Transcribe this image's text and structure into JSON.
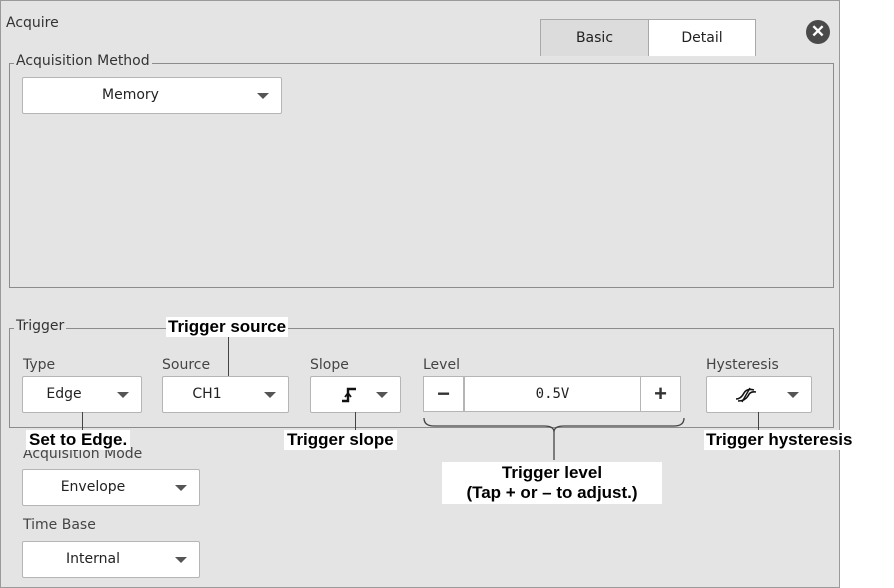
{
  "window": {
    "title": "Acquire",
    "close_icon": "close-icon"
  },
  "tabs": [
    {
      "label": "Basic"
    },
    {
      "label": "Detail"
    }
  ],
  "acquisition_method": {
    "group_label": "Acquisition Method",
    "value": "Memory"
  },
  "trigger": {
    "group_label": "Trigger",
    "type": {
      "label": "Type",
      "value": "Edge"
    },
    "source": {
      "label": "Source",
      "value": "CH1"
    },
    "slope": {
      "label": "Slope",
      "icon": "rising-edge-icon"
    },
    "level": {
      "label": "Level",
      "value": "0.5V",
      "minus": "−",
      "plus": "+"
    },
    "hysteresis": {
      "label": "Hysteresis",
      "icon": "hysteresis-icon"
    }
  },
  "acquisition_mode": {
    "label": "Acquisition Mode",
    "value": "Envelope"
  },
  "time_base": {
    "label": "Time Base",
    "value": "Internal"
  },
  "callouts": {
    "trigger_source": "Trigger source",
    "set_to_edge": "Set to Edge.",
    "trigger_slope": "Trigger slope",
    "trigger_hysteresis": "Trigger hysteresis",
    "trigger_level_1": "Trigger level",
    "trigger_level_2": "(Tap + or – to adjust.)"
  }
}
